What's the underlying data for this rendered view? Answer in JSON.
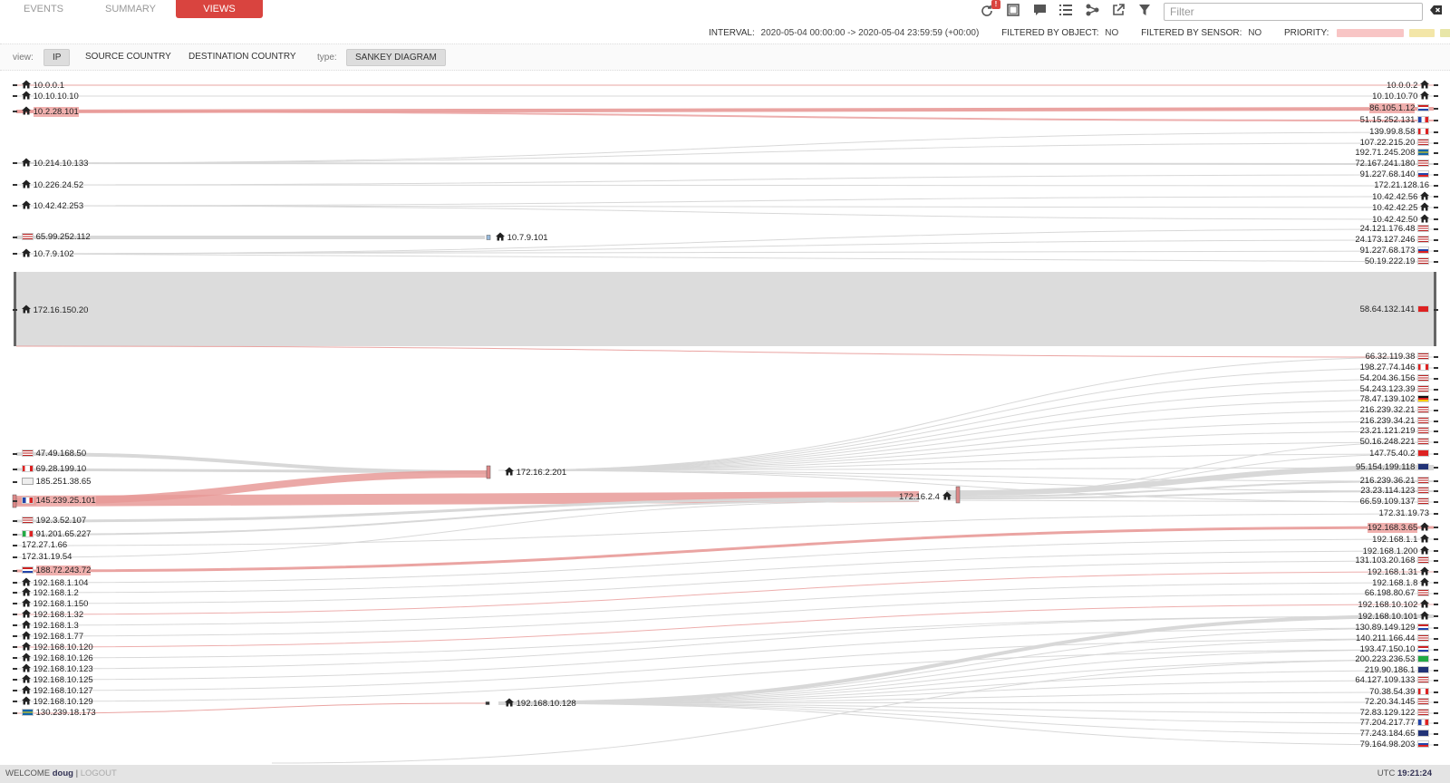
{
  "tabs": [
    "EVENTS",
    "SUMMARY",
    "VIEWS"
  ],
  "active_tab": "VIEWS",
  "toolbar": {
    "icons": [
      "refresh-icon",
      "fullscreen-icon",
      "comment-icon",
      "list-icon",
      "share-icon",
      "external-link-icon",
      "filter-icon"
    ],
    "badge": "!"
  },
  "filter": {
    "placeholder": "Filter"
  },
  "info": {
    "interval_label": "INTERVAL:",
    "interval_value": "2020-05-04 00:00:00 -> 2020-05-04 23:59:59 (+00:00)",
    "object_label": "FILTERED BY OBJECT:",
    "object_value": "NO",
    "sensor_label": "FILTERED BY SENSOR:",
    "sensor_value": "NO",
    "priority_label": "PRIORITY:",
    "priority_colors": [
      "#f8c5c5",
      "#f3e6a8",
      "#e8e6a8",
      "#e6e6e6"
    ]
  },
  "viewbar": {
    "view_label": "view:",
    "views": [
      "IP",
      "SOURCE COUNTRY",
      "DESTINATION COUNTRY"
    ],
    "selected_view": "IP",
    "type_label": "type:",
    "type_value": "SANKEY DIAGRAM"
  },
  "sankey": {
    "left": [
      {
        "ip": "10.0.0.1",
        "icon": "home"
      },
      {
        "ip": "10.10.10.10",
        "icon": "home"
      },
      {
        "ip": "10.2.28.101",
        "icon": "home",
        "hl": true
      },
      {
        "ip": "10.214.10.133",
        "icon": "home"
      },
      {
        "ip": "10.226.24.52",
        "icon": "home"
      },
      {
        "ip": "10.42.42.253",
        "icon": "home"
      },
      {
        "ip": "65.99.252.112",
        "icon": "flag-us"
      },
      {
        "ip": "10.7.9.102",
        "icon": "home"
      },
      {
        "ip": "172.16.150.20",
        "icon": "home"
      },
      {
        "ip": "47.49.168.50",
        "icon": "flag-us"
      },
      {
        "ip": "69.28.199.10",
        "icon": "flag-ca"
      },
      {
        "ip": "185.251.38.65",
        "icon": "image"
      },
      {
        "ip": "145.239.25.101",
        "icon": "flag-fr",
        "hl": true
      },
      {
        "ip": "192.3.52.107",
        "icon": "flag-us"
      },
      {
        "ip": "91.201.65.227",
        "icon": "flag-it"
      },
      {
        "ip": "172.27.1.66",
        "icon": ""
      },
      {
        "ip": "172.31.19.54",
        "icon": ""
      },
      {
        "ip": "188.72.243.72",
        "icon": "flag-nl",
        "hl": true
      },
      {
        "ip": "192.168.1.104",
        "icon": "home"
      },
      {
        "ip": "192.168.1.2",
        "icon": "home"
      },
      {
        "ip": "192.168.1.150",
        "icon": "home"
      },
      {
        "ip": "192.168.1.32",
        "icon": "home"
      },
      {
        "ip": "192.168.1.3",
        "icon": "home"
      },
      {
        "ip": "192.168.1.77",
        "icon": "home"
      },
      {
        "ip": "192.168.10.120",
        "icon": "home"
      },
      {
        "ip": "192.168.10.126",
        "icon": "home"
      },
      {
        "ip": "192.168.10.123",
        "icon": "home"
      },
      {
        "ip": "192.168.10.125",
        "icon": "home"
      },
      {
        "ip": "192.168.10.127",
        "icon": "home"
      },
      {
        "ip": "192.168.10.129",
        "icon": "home"
      },
      {
        "ip": "130.239.18.173",
        "icon": "flag-se"
      }
    ],
    "middle": [
      {
        "ip": "10.7.9.101",
        "icon": "home"
      },
      {
        "ip": "172.16.2.201",
        "icon": "home"
      },
      {
        "ip": "172.16.2.4",
        "icon": "home"
      },
      {
        "ip": "192.168.10.128",
        "icon": "home"
      }
    ],
    "right": [
      {
        "ip": "10.0.0.2",
        "icon": "home"
      },
      {
        "ip": "10.10.10.70",
        "icon": "home"
      },
      {
        "ip": "86.105.1.12",
        "icon": "flag-nl",
        "hl": true
      },
      {
        "ip": "51.15.252.131",
        "icon": "flag-fr"
      },
      {
        "ip": "139.99.8.58",
        "icon": "flag-ca"
      },
      {
        "ip": "107.22.215.20",
        "icon": "flag-us"
      },
      {
        "ip": "192.71.245.208",
        "icon": "flag-se"
      },
      {
        "ip": "72.167.241.180",
        "icon": "flag-us"
      },
      {
        "ip": "91.227.68.140",
        "icon": "flag-ru"
      },
      {
        "ip": "172.21.128.16",
        "icon": ""
      },
      {
        "ip": "10.42.42.56",
        "icon": "home"
      },
      {
        "ip": "10.42.42.25",
        "icon": "home"
      },
      {
        "ip": "10.42.42.50",
        "icon": "home"
      },
      {
        "ip": "24.121.176.48",
        "icon": "flag-us"
      },
      {
        "ip": "24.173.127.246",
        "icon": "flag-us"
      },
      {
        "ip": "91.227.68.173",
        "icon": "flag-ru"
      },
      {
        "ip": "50.19.222.19",
        "icon": "flag-us"
      },
      {
        "ip": "58.64.132.141",
        "icon": "flag-hk"
      },
      {
        "ip": "66.32.119.38",
        "icon": "flag-us"
      },
      {
        "ip": "198.27.74.146",
        "icon": "flag-ca"
      },
      {
        "ip": "54.204.36.156",
        "icon": "flag-us"
      },
      {
        "ip": "54.243.123.39",
        "icon": "flag-us"
      },
      {
        "ip": "78.47.139.102",
        "icon": "flag-de"
      },
      {
        "ip": "216.239.32.21",
        "icon": "flag-us"
      },
      {
        "ip": "216.239.34.21",
        "icon": "flag-us"
      },
      {
        "ip": "23.21.121.219",
        "icon": "flag-us"
      },
      {
        "ip": "50.16.248.221",
        "icon": "flag-us"
      },
      {
        "ip": "147.75.40.2",
        "icon": "flag-ch"
      },
      {
        "ip": "95.154.199.118",
        "icon": "flag-gb"
      },
      {
        "ip": "216.239.36.21",
        "icon": "flag-us"
      },
      {
        "ip": "23.23.114.123",
        "icon": "flag-us"
      },
      {
        "ip": "66.59.109.137",
        "icon": "flag-us"
      },
      {
        "ip": "172.31.19.73",
        "icon": ""
      },
      {
        "ip": "192.168.3.65",
        "icon": "home",
        "hl": true
      },
      {
        "ip": "192.168.1.1",
        "icon": "home"
      },
      {
        "ip": "192.168.1.200",
        "icon": "home"
      },
      {
        "ip": "131.103.20.168",
        "icon": "flag-us"
      },
      {
        "ip": "192.168.1.31",
        "icon": "home"
      },
      {
        "ip": "192.168.1.8",
        "icon": "home"
      },
      {
        "ip": "66.198.80.67",
        "icon": "flag-us"
      },
      {
        "ip": "192.168.10.102",
        "icon": "home"
      },
      {
        "ip": "192.168.10.101",
        "icon": "home"
      },
      {
        "ip": "130.89.149.129",
        "icon": "flag-nl"
      },
      {
        "ip": "140.211.166.44",
        "icon": "flag-us"
      },
      {
        "ip": "193.47.150.10",
        "icon": "flag-nl"
      },
      {
        "ip": "200.223.236.53",
        "icon": "flag-br"
      },
      {
        "ip": "219.90.186.1",
        "icon": "flag-au"
      },
      {
        "ip": "64.127.109.133",
        "icon": "flag-us"
      },
      {
        "ip": "70.38.54.39",
        "icon": "flag-ca"
      },
      {
        "ip": "72.20.34.145",
        "icon": "flag-us"
      },
      {
        "ip": "72.83.129.122",
        "icon": "flag-us"
      },
      {
        "ip": "77.204.217.77",
        "icon": "flag-fr"
      },
      {
        "ip": "77.243.184.65",
        "icon": "flag-eu"
      },
      {
        "ip": "79.164.98.203",
        "icon": "flag-ru"
      }
    ],
    "highlight_color": "#e89a98",
    "link_color": "#d8d8d8"
  },
  "footer": {
    "welcome": "WELCOME",
    "user": "doug",
    "sep": "|",
    "logout": "LOGOUT",
    "tz": "UTC",
    "time": "19:21:24"
  }
}
